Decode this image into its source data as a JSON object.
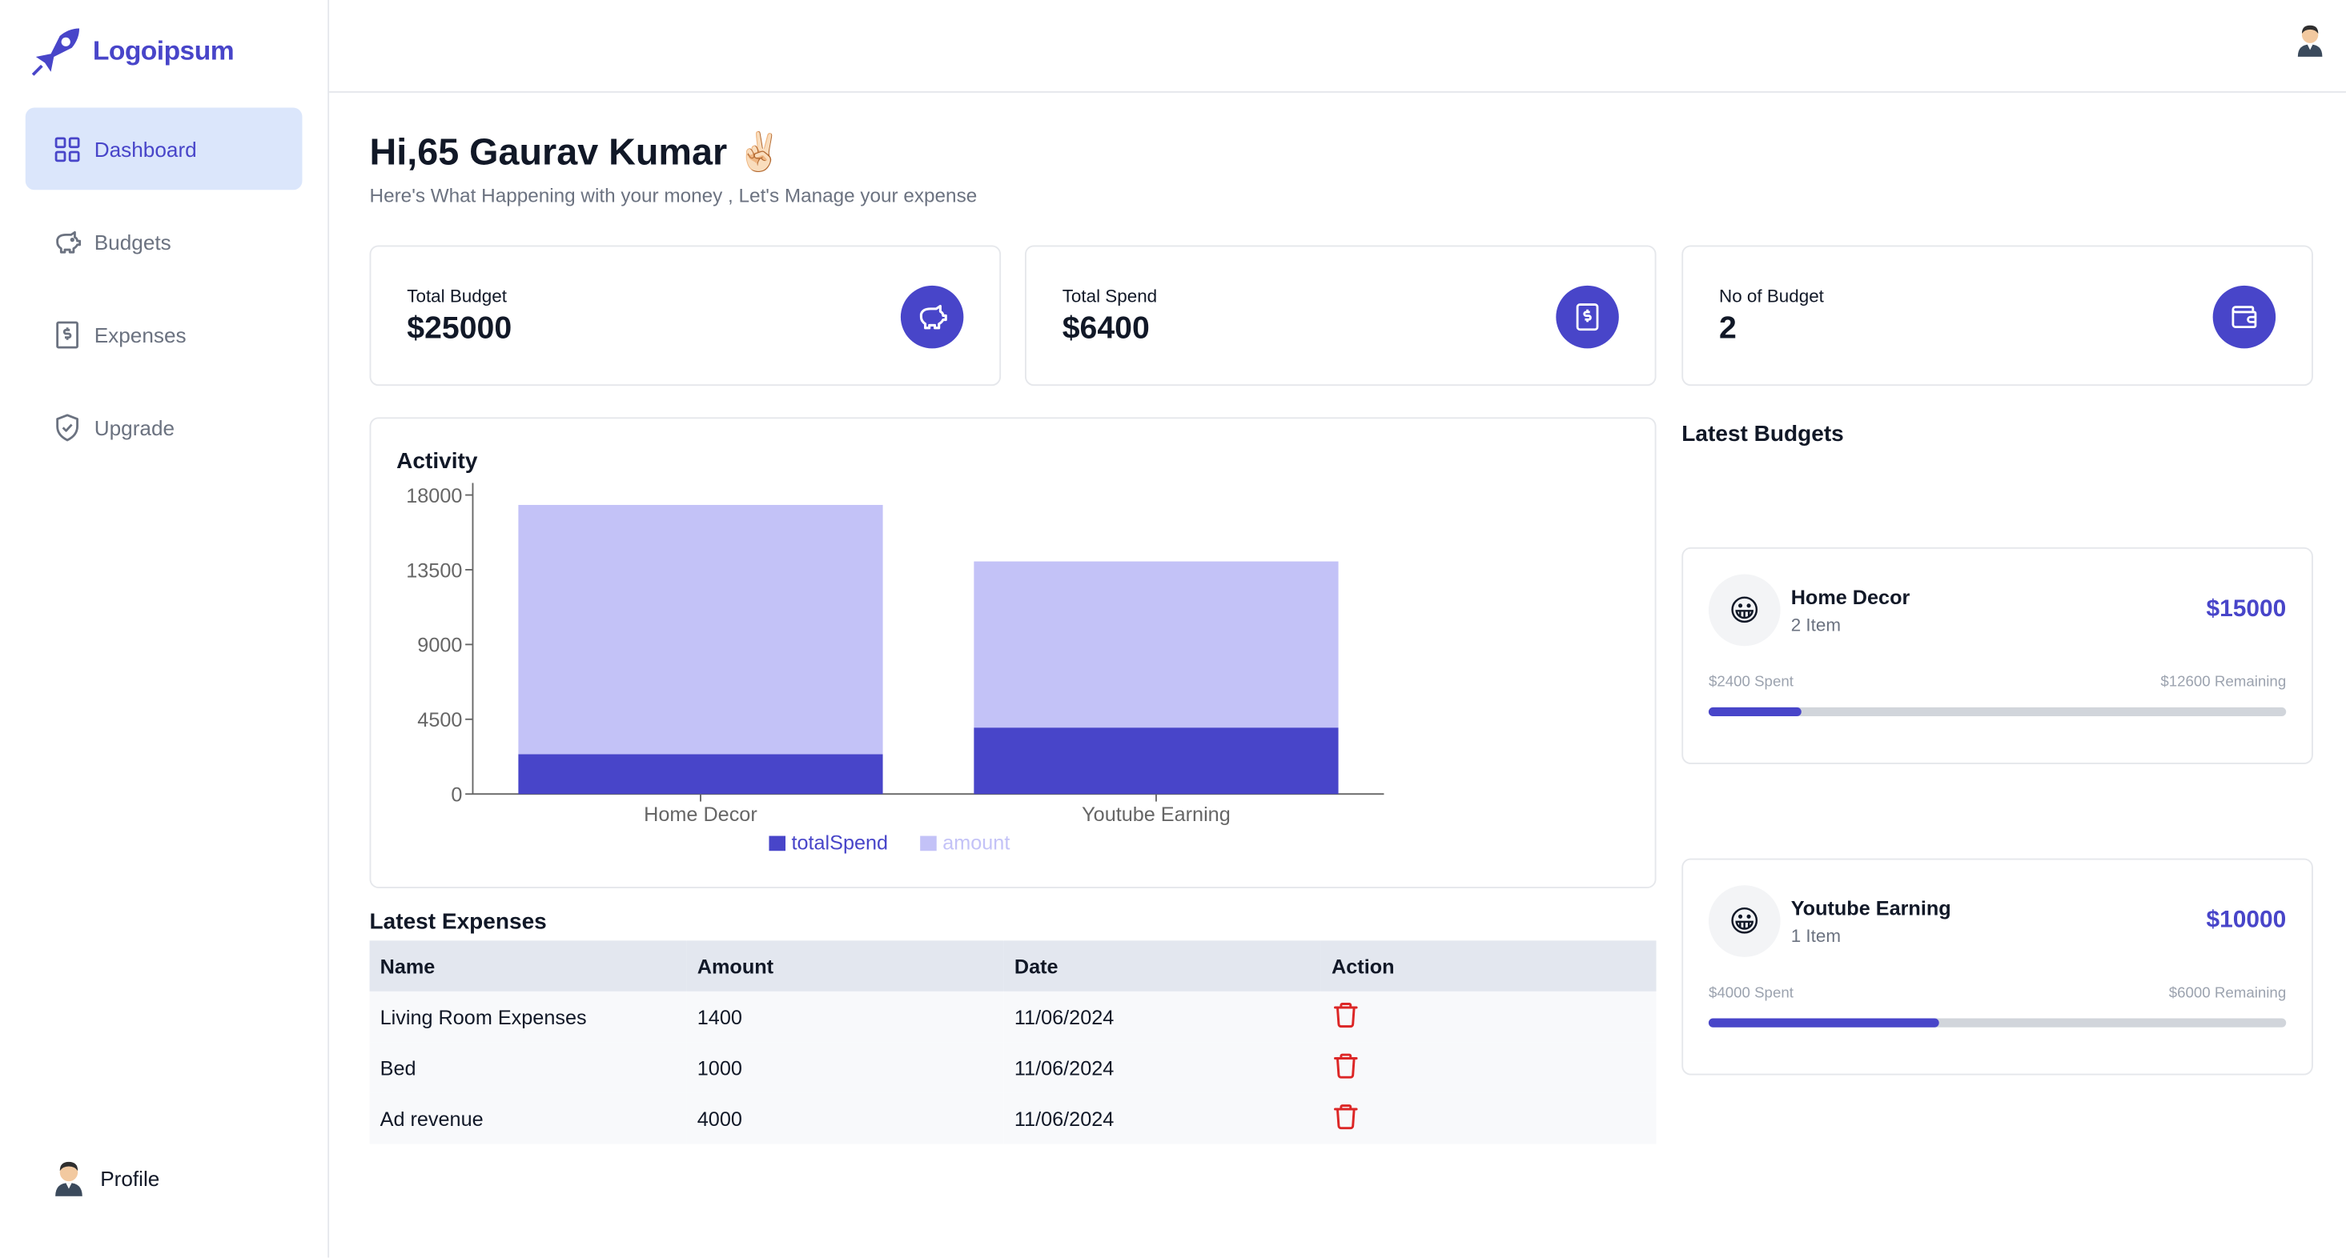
{
  "brand": {
    "name": "Logoipsum",
    "accent": "#4845c9"
  },
  "sidebar": {
    "items": [
      {
        "label": "Dashboard",
        "icon": "layout-grid-icon",
        "active": true
      },
      {
        "label": "Budgets",
        "icon": "piggy-bank-icon",
        "active": false
      },
      {
        "label": "Expenses",
        "icon": "receipt-icon",
        "active": false
      },
      {
        "label": "Upgrade",
        "icon": "shield-check-icon",
        "active": false
      }
    ],
    "profile_label": "Profile"
  },
  "header": {
    "avatar_icon": "user-avatar-icon"
  },
  "greeting": {
    "title": "Hi,65 Gaurav Kumar",
    "emoji": "✌🏻",
    "subtitle": "Here's What Happening with your money , Let's Manage your expense"
  },
  "summary_cards": [
    {
      "label": "Total Budget",
      "value": "$25000",
      "icon": "piggy-bank-icon"
    },
    {
      "label": "Total Spend",
      "value": "$6400",
      "icon": "receipt-icon"
    },
    {
      "label": "No of Budget",
      "value": "2",
      "icon": "wallet-icon"
    }
  ],
  "activity": {
    "title": "Activity"
  },
  "chart_data": {
    "type": "bar",
    "stacked": true,
    "categories": [
      "Home Decor",
      "Youtube Earning"
    ],
    "series": [
      {
        "name": "totalSpend",
        "values": [
          2400,
          4000
        ],
        "color": "#4845c9"
      },
      {
        "name": "amount",
        "values": [
          15000,
          10000
        ],
        "color": "#c3c2f7"
      }
    ],
    "yticks": [
      0,
      4500,
      9000,
      13500,
      18000
    ],
    "ylim": [
      0,
      18000
    ],
    "legend": "bottom",
    "grid": false
  },
  "latest_expenses": {
    "title": "Latest Expenses",
    "columns": [
      "Name",
      "Amount",
      "Date",
      "Action"
    ],
    "rows": [
      {
        "name": "Living Room Expenses",
        "amount": "1400",
        "date": "11/06/2024"
      },
      {
        "name": "Bed",
        "amount": "1000",
        "date": "11/06/2024"
      },
      {
        "name": "Ad revenue",
        "amount": "4000",
        "date": "11/06/2024"
      }
    ],
    "delete_icon": "trash-icon"
  },
  "latest_budgets": {
    "title": "Latest Budgets",
    "items": [
      {
        "emoji": "😀",
        "name": "Home Decor",
        "items": "2 Item",
        "amount": "$15000",
        "spent": "$2400 Spent",
        "remaining": "$12600 Remaining",
        "progress": 0.16
      },
      {
        "emoji": "😀",
        "name": "Youtube Earning",
        "items": "1 Item",
        "amount": "$10000",
        "spent": "$4000 Spent",
        "remaining": "$6000 Remaining",
        "progress": 0.4
      }
    ]
  }
}
